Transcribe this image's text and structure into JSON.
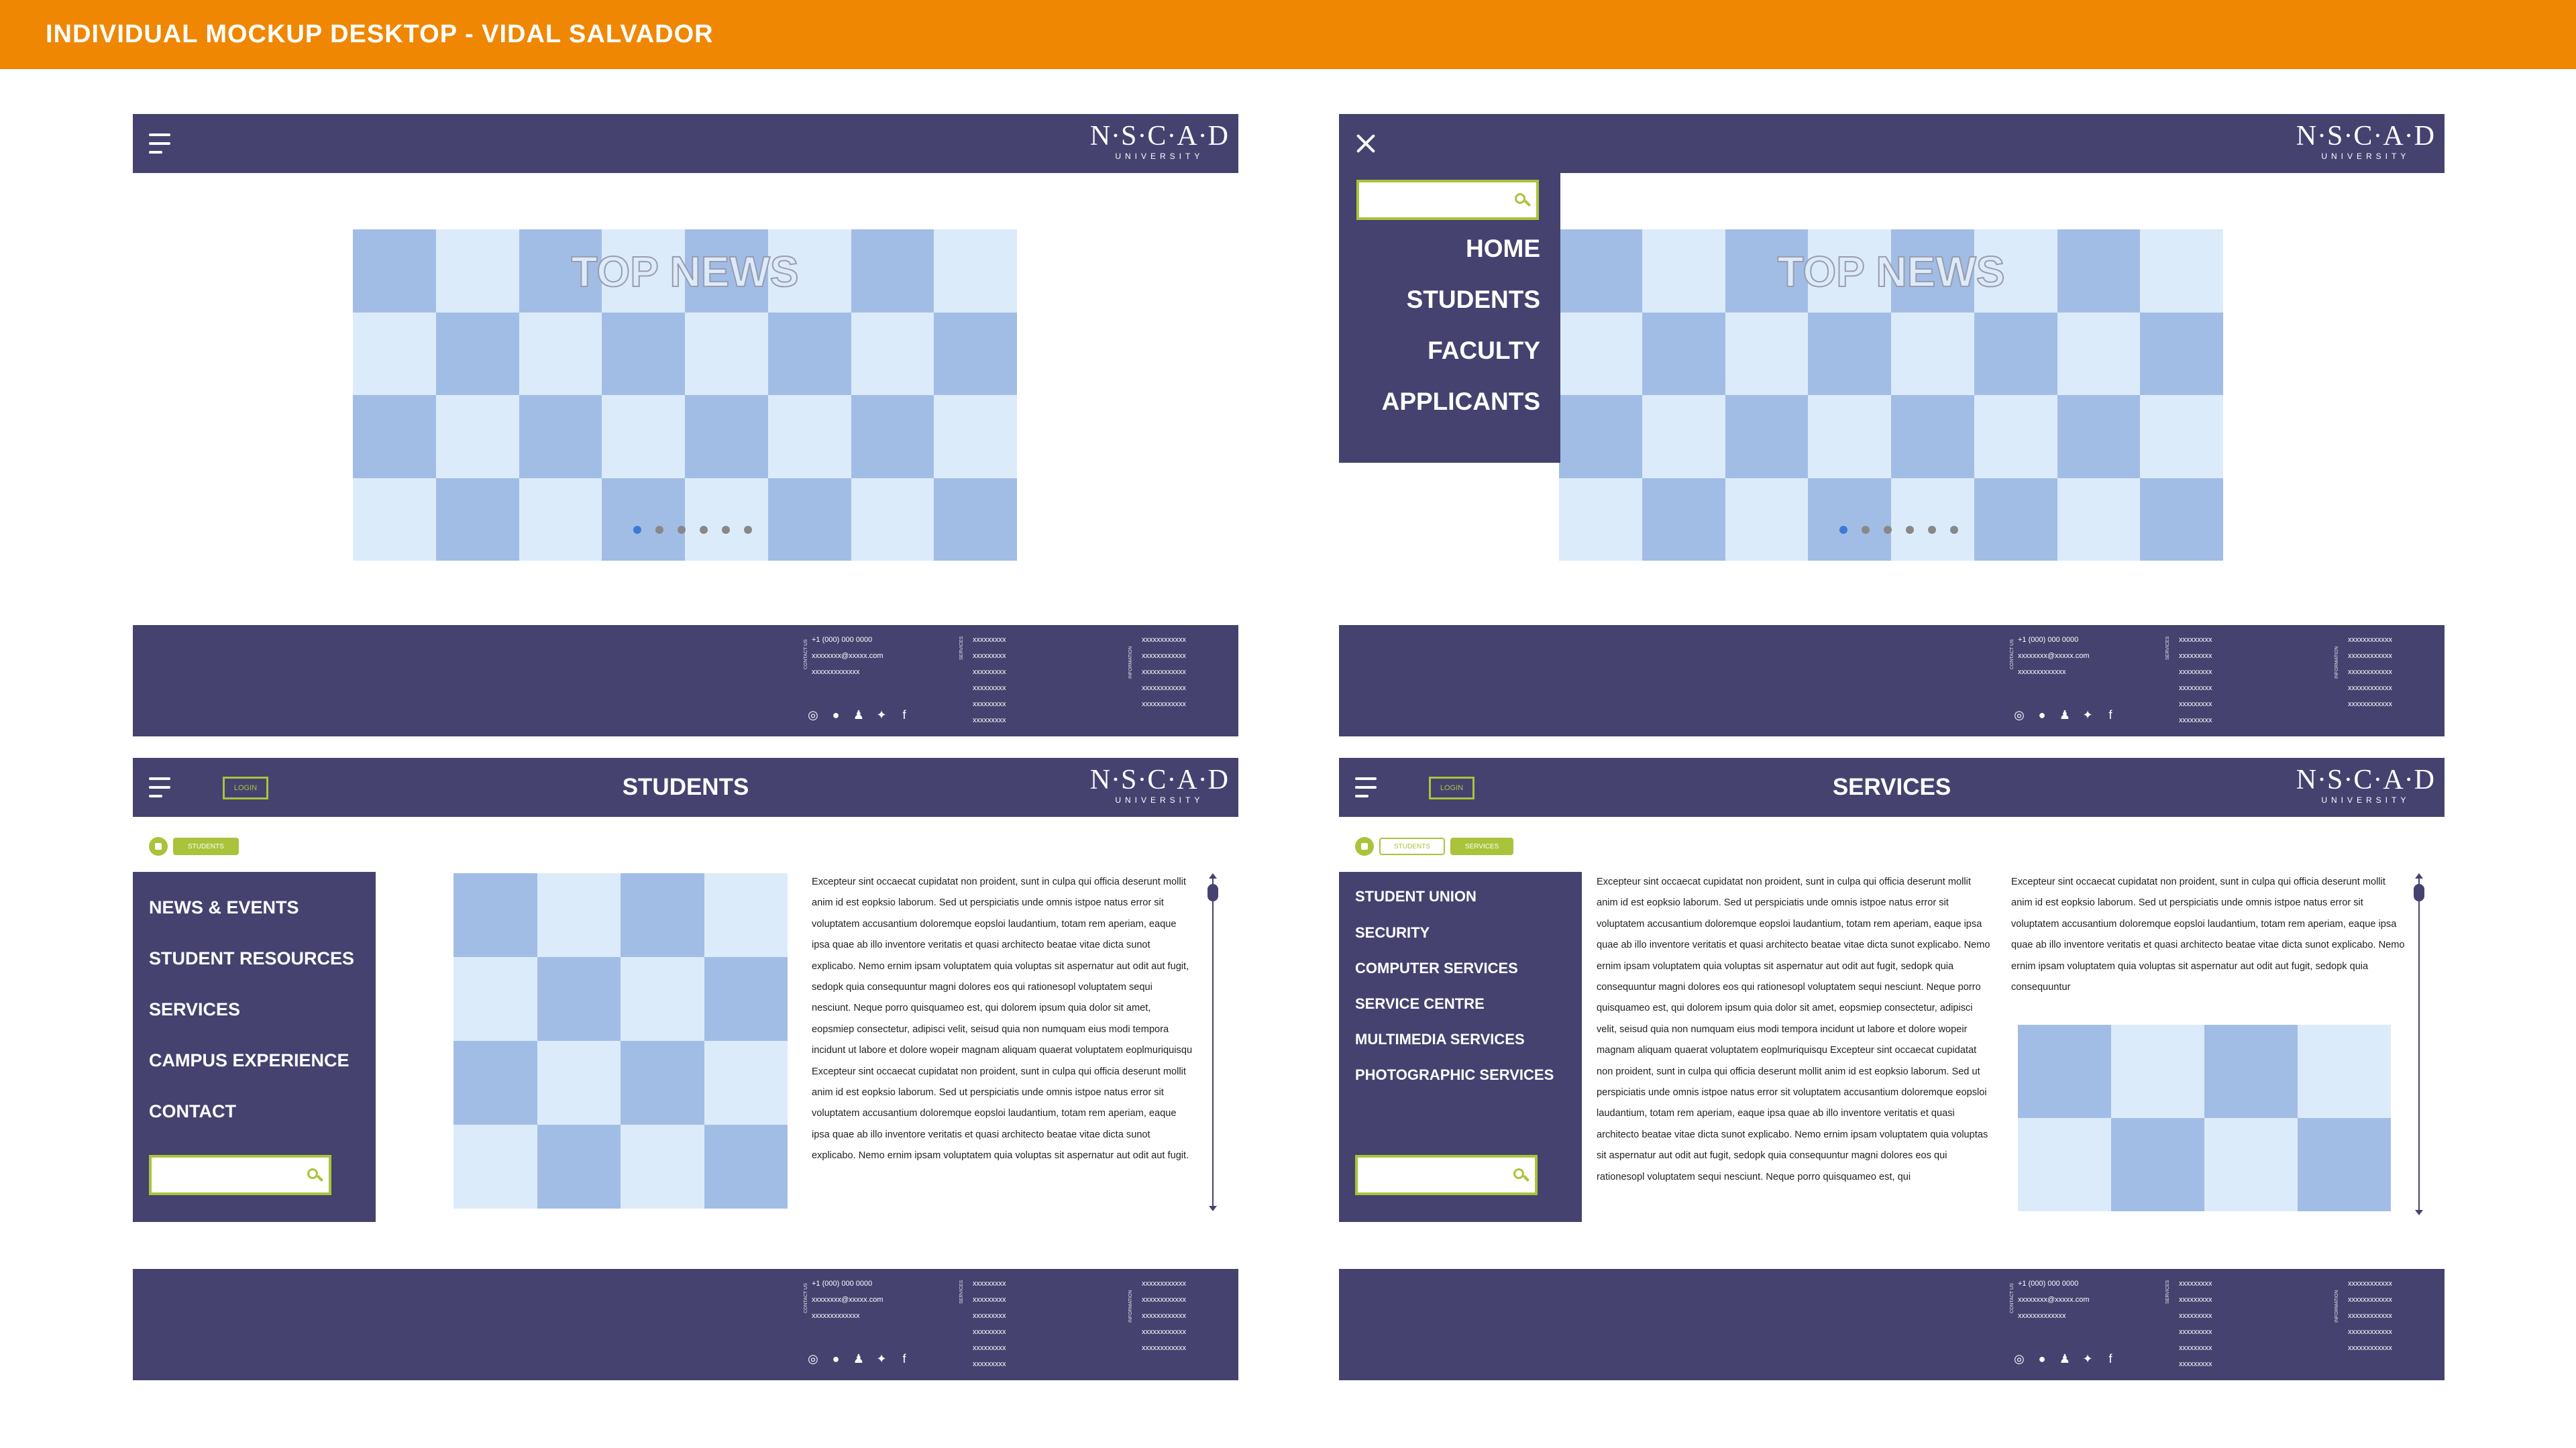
{
  "banner": {
    "title": "INDIVIDUAL MOCKUP DESKTOP - VIDAL SALVADOR"
  },
  "colors": {
    "orange": "#ef8702",
    "navy": "#454270",
    "accent": "#a9c43a",
    "light_tile": "#dcebfa",
    "dark_tile": "#a2bde5",
    "active_dot": "#3a7bd5"
  },
  "logo": {
    "line1": "N·S·C·A·D",
    "line2": "UNIVERSITY"
  },
  "hero": {
    "title": "TOP NEWS"
  },
  "menu": {
    "items": [
      "HOME",
      "STUDENTS",
      "FACULTY",
      "APPLICANTS"
    ]
  },
  "footer": {
    "contact_label": "CONTACT US",
    "phone": "+1 (000) 000 0000",
    "email": "xxxxxxxx@xxxxx.com",
    "contact_extra": "xxxxxxxxxxxxx",
    "services_label": "SERVICES",
    "services_items": [
      "xxxxxxxxx",
      "xxxxxxxxx",
      "xxxxxxxxx",
      "xxxxxxxxx",
      "xxxxxxxxx",
      "xxxxxxxxx"
    ],
    "info_label": "INFORMATION",
    "info_items": [
      "xxxxxxxxxxxx",
      "xxxxxxxxxxxx",
      "xxxxxxxxxxxx",
      "xxxxxxxxxxxx",
      "xxxxxxxxxxxx"
    ],
    "social_icons": [
      "instagram-icon",
      "globe-icon",
      "user-icon",
      "twitter-icon",
      "facebook-icon"
    ]
  },
  "students_page": {
    "title": "STUDENTS",
    "login": "LOGIN",
    "crumbs": [
      "STUDENTS"
    ],
    "sidebar": [
      "NEWS & EVENTS",
      "STUDENT RESOURCES",
      "SERVICES",
      "CAMPUS EXPERIENCE",
      "CONTACT"
    ],
    "body": "Excepteur sint occaecat cupidatat non proident, sunt in culpa qui officia deserunt mollit anim id est eopksio laborum. Sed ut perspiciatis unde omnis istpoe natus error sit voluptatem accusantium doloremque eopsloi laudantium, totam rem aperiam, eaque ipsa quae ab illo inventore veritatis et quasi architecto beatae vitae dicta sunot explicabo. Nemo ernim ipsam voluptatem quia voluptas sit aspernatur aut odit aut fugit, sedopk quia consequuntur magni dolores eos qui rationesopl voluptatem sequi nesciunt. Neque porro quisquameo est, qui dolorem ipsum quia dolor sit amet, eopsmiep consectetur, adipisci velit, seisud quia non numquam eius modi tempora incidunt ut labore et dolore wopeir magnam aliquam quaerat voluptatem eoplmuriquisqu Excepteur sint occaecat cupidatat non proident, sunt in culpa qui officia deserunt mollit anim id est eopksio laborum. Sed ut perspiciatis unde omnis istpoe natus error sit voluptatem accusantium doloremque eopsloi laudantium, totam rem aperiam, eaque ipsa quae ab illo inventore veritatis et quasi architecto beatae vitae dicta sunot explicabo. Nemo ernim ipsam voluptatem quia voluptas sit aspernatur aut odit aut fugit."
  },
  "services_page": {
    "title": "SERVICES",
    "login": "LOGIN",
    "crumbs": [
      "STUDENTS",
      "SERVICES"
    ],
    "sidebar": [
      "STUDENT UNION",
      "SECURITY",
      "COMPUTER SERVICES",
      "SERVICE CENTRE",
      "MULTIMEDIA SERVICES",
      "PHOTOGRAPHIC SERVICES"
    ],
    "body1": "Excepteur sint occaecat cupidatat non proident, sunt in culpa qui officia deserunt mollit anim id est eopksio laborum. Sed ut perspiciatis unde omnis istpoe natus error sit voluptatem accusantium doloremque eopsloi laudantium, totam rem aperiam, eaque ipsa quae ab illo inventore veritatis et quasi architecto beatae vitae dicta sunot explicabo. Nemo ernim ipsam voluptatem quia voluptas sit aspernatur aut odit aut fugit, sedopk quia consequuntur magni dolores eos qui rationesopl voluptatem sequi nesciunt. Neque porro quisquameo est, qui dolorem ipsum quia dolor sit amet, eopsmiep consectetur, adipisci velit, seisud quia non numquam eius modi tempora incidunt ut labore et dolore wopeir magnam aliquam quaerat voluptatem eoplmuriquisqu Excepteur sint occaecat cupidatat non proident, sunt in culpa qui officia deserunt mollit anim id est eopksio laborum. Sed ut perspiciatis unde omnis istpoe natus error sit voluptatem accusantium doloremque eopsloi laudantium, totam rem aperiam, eaque ipsa quae ab illo inventore veritatis et quasi architecto beatae vitae dicta sunot explicabo. Nemo ernim ipsam voluptatem quia voluptas sit aspernatur aut odit aut fugit, sedopk quia consequuntur magni dolores eos qui rationesopl voluptatem sequi nesciunt. Neque porro quisquameo est, qui",
    "body2": "Excepteur sint occaecat cupidatat non proident, sunt in culpa qui officia deserunt mollit anim id est eopksio laborum. Sed ut perspiciatis unde omnis istpoe natus error sit voluptatem accusantium doloremque eopsloi laudantium, totam rem aperiam, eaque ipsa quae ab illo inventore veritatis et quasi architecto beatae vitae dicta sunot explicabo. Nemo ernim ipsam voluptatem quia voluptas sit aspernatur aut odit aut fugit, sedopk quia consequuntur"
  }
}
